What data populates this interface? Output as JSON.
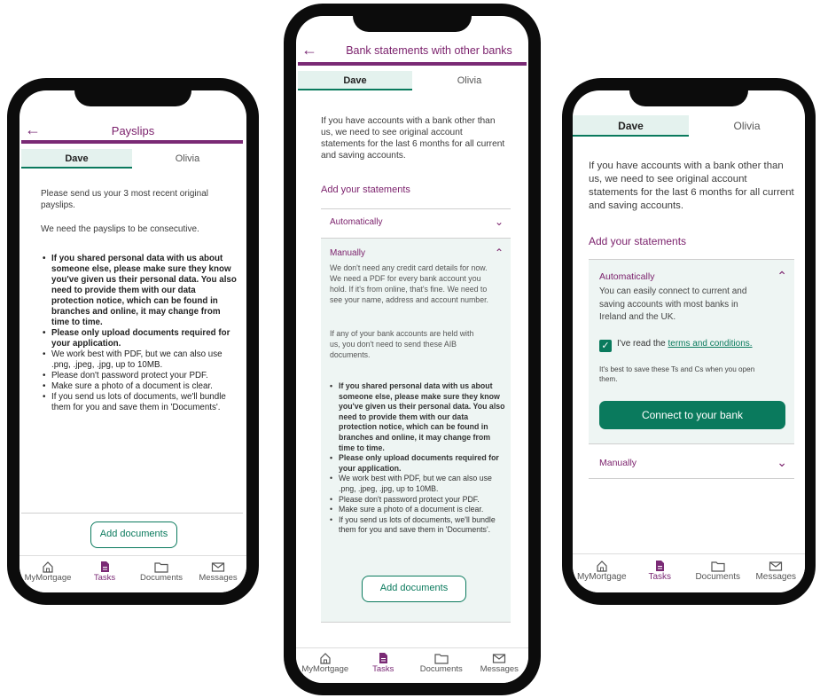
{
  "phone1": {
    "title": "Payslips",
    "tabs": [
      "Dave",
      "Olivia"
    ],
    "intro": "Please send us your 3 most recent original payslips.",
    "consecutive": "We need the payslips to be consecutive.",
    "bullets": [
      {
        "text": "If you shared personal data with us about someone else, please make sure they know you've given us their personal data. You also need to provide them with our data protection notice, which can be found in branches and online, it may change from time to time.",
        "bold": true
      },
      {
        "text": "Please only upload documents required for your application.",
        "bold": true
      },
      {
        "text": "We work best with PDF, but we can also use .png, .jpeg, .jpg, up to 10MB.",
        "bold": false
      },
      {
        "text": "Please don't password protect your PDF.",
        "bold": false
      },
      {
        "text": "Make sure a photo of a document is clear.",
        "bold": false
      },
      {
        "text": "If you send us lots of documents, we'll bundle them for you and save them in 'Documents'.",
        "bold": false
      }
    ],
    "button": "Add documents"
  },
  "phone2": {
    "title": "Bank statements with other banks",
    "tabs": [
      "Dave",
      "Olivia"
    ],
    "intro": "If you have accounts with a bank other than us, we need to see original account statements for the last 6 months for all current and saving accounts.",
    "section_title": "Add your statements",
    "automatically": "Automatically",
    "manually": "Manually",
    "manual_p1": "We don't need any credit card details for now. We need a PDF for every bank account you hold. If it's from online, that's fine. We need to see your name, address and account number.",
    "manual_p2": "If any of your bank accounts are held with us, you don't need to send these AIB documents.",
    "bullets": [
      {
        "text": "If you shared personal data with us about someone else, please make sure they know you've given us their personal data. You also need to provide them with our data protection notice, which can be found in branches and online, it may change from time to time.",
        "bold": true
      },
      {
        "text": "Please only upload documents required for your application.",
        "bold": true
      },
      {
        "text": "We work best with PDF, but we can also use .png, .jpeg, .jpg, up to 10MB.",
        "bold": false
      },
      {
        "text": "Please don't password protect your PDF.",
        "bold": false
      },
      {
        "text": "Make sure a photo of a document is clear.",
        "bold": false
      },
      {
        "text": "If you send us lots of documents, we'll bundle them for you and save them in 'Documents'.",
        "bold": false
      }
    ],
    "button": "Add documents"
  },
  "phone3": {
    "tabs": [
      "Dave",
      "Olivia"
    ],
    "intro": "If you have accounts with a bank other than us, we need to see original account statements for the last 6 months for all current and saving accounts.",
    "section_title": "Add your statements",
    "automatically": "Automatically",
    "auto_text": "You can easily connect to current and saving accounts with most banks in Ireland and the UK.",
    "terms_prefix": "I've read the ",
    "terms_link": "terms and conditions.",
    "save_hint": "It's best to save these Ts and Cs when you open them.",
    "connect_button": "Connect to your bank",
    "manually": "Manually"
  },
  "nav": {
    "items": [
      {
        "label": "MyMortgage",
        "icon": "home-icon"
      },
      {
        "label": "Tasks",
        "icon": "tasks-icon"
      },
      {
        "label": "Documents",
        "icon": "folder-icon"
      },
      {
        "label": "Messages",
        "icon": "mail-icon"
      }
    ],
    "active": "Tasks"
  },
  "colors": {
    "brand_purple": "#7a2a75",
    "accent_green": "#0a7a5d",
    "tab_bg": "#e4f2ee"
  }
}
